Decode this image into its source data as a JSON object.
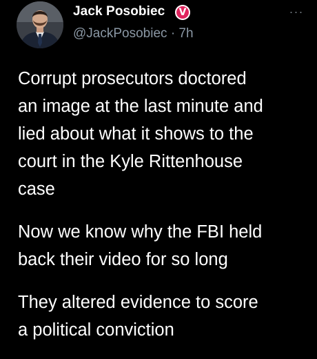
{
  "tweet": {
    "author_name": "Jack Posobiec",
    "verified_badge": "V",
    "handle": "@JackPosobiec",
    "separator": "·",
    "time": "7h",
    "more_glyph": "···",
    "paragraphs": [
      "Corrupt prosecutors doctored\nan image at the last minute and\nlied about what it shows to the\ncourt in the Kyle Rittenhouse\ncase",
      "Now we know why the FBI held\nback their video for so long",
      "They altered evidence to score\na political conviction"
    ]
  },
  "colors": {
    "background": "#000000",
    "text_primary": "#ffffff",
    "text_secondary": "#8b98a5",
    "badge": "#e0245e"
  },
  "icons": {
    "more": "more-horizontal-icon",
    "verified": "verified-badge-icon"
  }
}
